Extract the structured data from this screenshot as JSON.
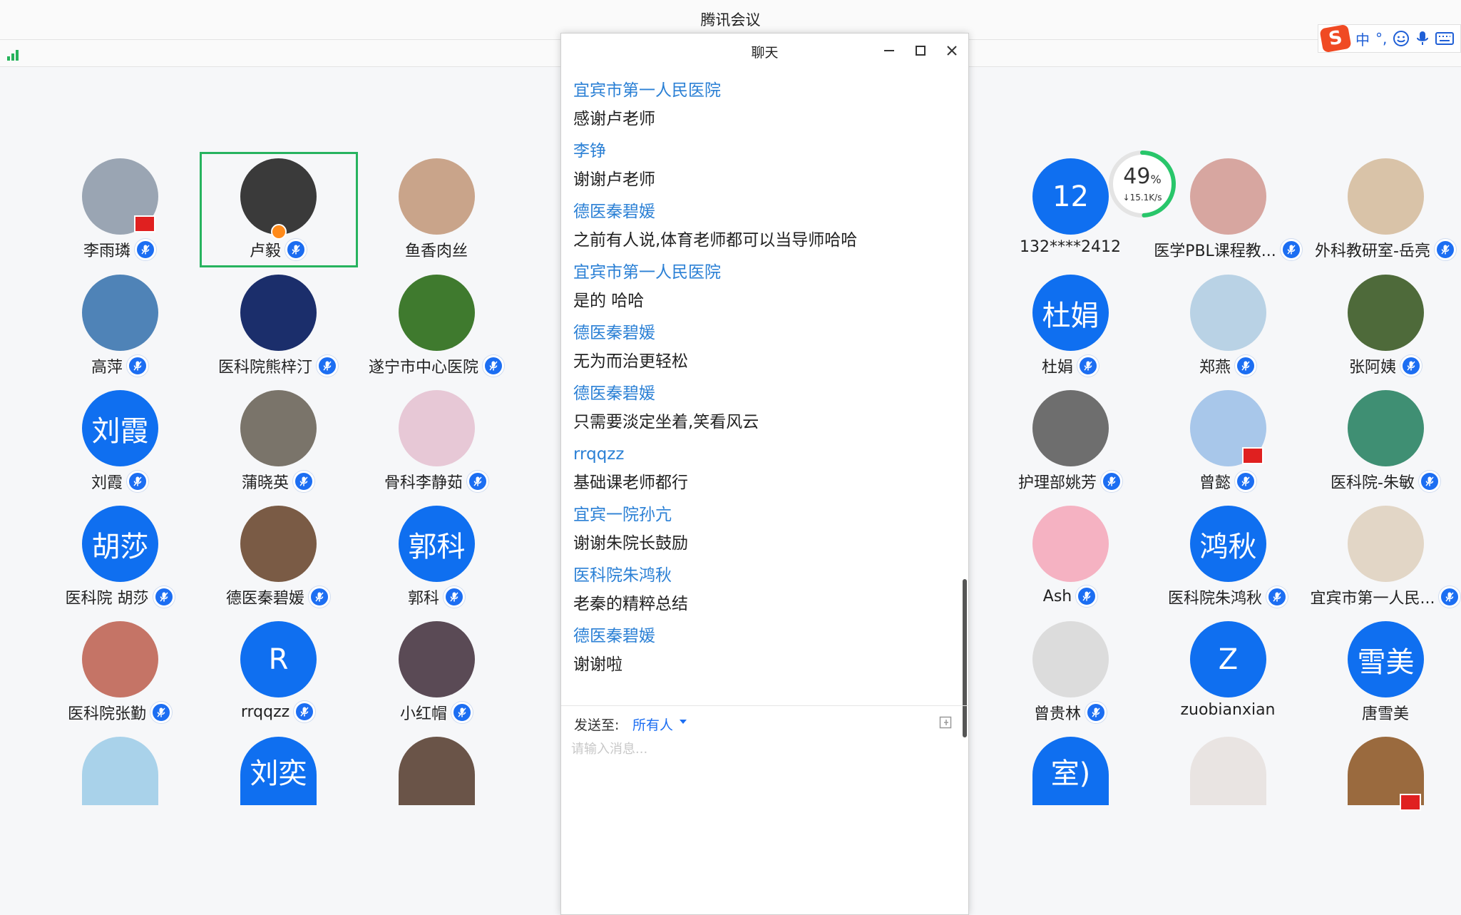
{
  "app": {
    "title": "腾讯会议"
  },
  "chat": {
    "title": "聊天",
    "send_to_label": "发送至:",
    "send_to_target": "所有人",
    "input_placeholder": "请输入消息...",
    "messages": [
      {
        "sender": "宜宾市第一人民医院",
        "text": "感谢卢老师"
      },
      {
        "sender": "李铮",
        "text": "谢谢卢老师"
      },
      {
        "sender": "德医秦碧媛",
        "text": "之前有人说,体育老师都可以当导师哈哈"
      },
      {
        "sender": "宜宾市第一人民医院",
        "text": "是的  哈哈"
      },
      {
        "sender": "德医秦碧媛",
        "text": "无为而治更轻松"
      },
      {
        "sender": "德医秦碧媛",
        "text": "只需要淡定坐着,笑看风云"
      },
      {
        "sender": "rrqqzz",
        "text": "基础课老师都行"
      },
      {
        "sender": "宜宾一院孙亢",
        "text": "谢谢朱院长鼓励"
      },
      {
        "sender": "医科院朱鸿秋",
        "text": "老秦的精粹总结"
      },
      {
        "sender": "德医秦碧媛",
        "text": "谢谢啦"
      }
    ]
  },
  "network": {
    "percent": "49",
    "percent_unit": "%",
    "rate": "↓15.1K/s"
  },
  "ime": {
    "logo": "S",
    "mode": "中",
    "punct": "°,"
  },
  "colors": {
    "accent": "#1c6ef2",
    "active_speaker": "#27b35f",
    "sender": "#2b80d5"
  },
  "participants": [
    {
      "name": "李雨璘",
      "avatar_text": "",
      "bg": "#9aa5b3",
      "flag": true
    },
    {
      "name": "卢毅",
      "avatar_text": "",
      "bg": "#3a3a3a",
      "host": true,
      "active": true,
      "mic": "solid"
    },
    {
      "name": "鱼香肉丝",
      "avatar_text": "",
      "bg": "#c9a48a",
      "mic": "none"
    },
    {
      "name": "高萍",
      "avatar_text": "",
      "bg": "#4f83b7"
    },
    {
      "name": "医科院熊梓汀",
      "avatar_text": "",
      "bg": "#1b2e6b"
    },
    {
      "name": "遂宁市中心医院",
      "avatar_text": "",
      "bg": "#3f7a2e"
    },
    {
      "name": "刘霞",
      "avatar_text": "刘霞",
      "bg": "#0f6ff0"
    },
    {
      "name": "蒲晓英",
      "avatar_text": "",
      "bg": "#7a746a"
    },
    {
      "name": "骨科李静茹",
      "avatar_text": "",
      "bg": "#e7c8d6"
    },
    {
      "name": "医科院 胡莎",
      "avatar_text": "胡莎",
      "bg": "#0f6ff0"
    },
    {
      "name": "德医秦碧媛",
      "avatar_text": "",
      "bg": "#7a5b45"
    },
    {
      "name": "郭科",
      "avatar_text": "郭科",
      "bg": "#0f6ff0"
    },
    {
      "name": "医科院张勤",
      "avatar_text": "",
      "bg": "#c57466"
    },
    {
      "name": "rrqqzz",
      "avatar_text": "R",
      "bg": "#0f6ff0"
    },
    {
      "name": "小红帽",
      "avatar_text": "",
      "bg": "#5a4a55"
    },
    {
      "name": "",
      "avatar_text": "",
      "bg": "#a9d2ea",
      "mic": "none"
    },
    {
      "name": "",
      "avatar_text": "刘奕",
      "bg": "#0f6ff0",
      "mic": "none"
    },
    {
      "name": "",
      "avatar_text": "",
      "bg": "#6a5448",
      "mic": "none"
    },
    {
      "name": "132****2412",
      "avatar_text": "12",
      "bg": "#0f6ff0",
      "mic": "none"
    },
    {
      "name": "医学PBL课程教...",
      "avatar_text": "",
      "bg": "#d7a6a0"
    },
    {
      "name": "外科教研室-岳亮",
      "avatar_text": "",
      "bg": "#d9c3a8"
    },
    {
      "name": "杜娟",
      "avatar_text": "杜娟",
      "bg": "#0f6ff0"
    },
    {
      "name": "郑燕",
      "avatar_text": "",
      "bg": "#b9d2e5"
    },
    {
      "name": "张阿姨",
      "avatar_text": "",
      "bg": "#4e6a3a"
    },
    {
      "name": "护理部姚芳",
      "avatar_text": "",
      "bg": "#6e6e6e"
    },
    {
      "name": "曾懿",
      "avatar_text": "",
      "bg": "#a8c7ea",
      "flag": true
    },
    {
      "name": "医科院-朱敏",
      "avatar_text": "",
      "bg": "#3f8f73"
    },
    {
      "name": "Ash",
      "avatar_text": "",
      "bg": "#f5b2c2"
    },
    {
      "name": "医科院朱鸿秋",
      "avatar_text": "鸿秋",
      "bg": "#0f6ff0"
    },
    {
      "name": "宜宾市第一人民...",
      "avatar_text": "",
      "bg": "#e2d6c6"
    },
    {
      "name": "曾贵林",
      "avatar_text": "",
      "bg": "#dcdcdc"
    },
    {
      "name": "zuobianxian",
      "avatar_text": "Z",
      "bg": "#0f6ff0",
      "mic": "none"
    },
    {
      "name": "唐雪美",
      "avatar_text": "雪美",
      "bg": "#0f6ff0",
      "mic": "none"
    },
    {
      "name": "",
      "avatar_text": "室)",
      "bg": "#0f6ff0",
      "mic": "none"
    },
    {
      "name": "",
      "avatar_text": "",
      "bg": "#e9e4e2",
      "mic": "none"
    },
    {
      "name": "",
      "avatar_text": "",
      "bg": "#9a6a3e",
      "mic": "none",
      "flag": true
    }
  ]
}
